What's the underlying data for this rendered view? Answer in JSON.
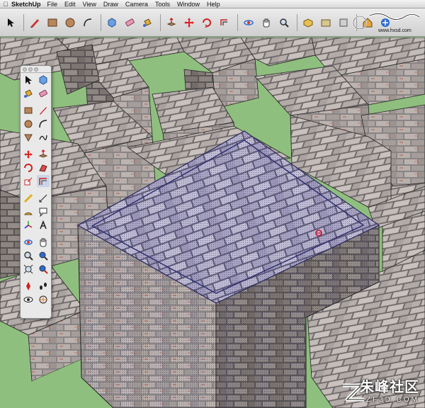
{
  "menubar": {
    "app_name": "SketchUp",
    "menus": [
      "File",
      "Edit",
      "View",
      "Draw",
      "Camera",
      "Tools",
      "Window",
      "Help"
    ]
  },
  "watermark_top": {
    "text": "www.hxsd.com"
  },
  "watermark_bottom": {
    "chinese": "朱峰社区",
    "english": "ZF3D.COM"
  },
  "toolbar": {
    "tools": [
      {
        "icon": "select-arrow-icon"
      },
      {
        "icon": "pencil-icon"
      },
      {
        "icon": "rectangle-icon"
      },
      {
        "icon": "circle-icon"
      },
      {
        "icon": "arc-icon"
      },
      {
        "icon": "make-component-icon"
      },
      {
        "icon": "eraser-icon"
      },
      {
        "icon": "paint-bucket-icon"
      },
      {
        "icon": "push-pull-icon"
      },
      {
        "icon": "move-icon"
      },
      {
        "icon": "rotate-icon"
      },
      {
        "icon": "offset-icon"
      },
      {
        "icon": "orbit-icon"
      },
      {
        "icon": "pan-hand-icon"
      },
      {
        "icon": "zoom-icon"
      },
      {
        "icon": "zoom-extents-icon"
      },
      {
        "icon": "previous-view-icon"
      },
      {
        "icon": "next-view-icon"
      },
      {
        "icon": "3d-warehouse-icon"
      },
      {
        "icon": "share-model-icon"
      }
    ]
  },
  "palette": {
    "rows": [
      [
        "select-arrow-icon",
        "make-component-icon"
      ],
      [
        "paint-bucket-icon",
        "eraser-icon"
      ],
      [
        "rectangle-icon",
        "line-icon"
      ],
      [
        "circle-icon",
        "arc-icon"
      ],
      [
        "polygon-icon",
        "freehand-icon"
      ],
      [
        "move-icon",
        "push-pull-icon"
      ],
      [
        "rotate-icon",
        "follow-me-icon"
      ],
      [
        "scale-icon",
        "offset-icon"
      ],
      [
        "tape-measure-icon",
        "dimension-icon"
      ],
      [
        "protractor-icon",
        "text-icon"
      ],
      [
        "axes-icon",
        "3d-text-icon"
      ],
      [
        "orbit-icon",
        "pan-icon"
      ],
      [
        "zoom-icon",
        "zoom-window-icon"
      ],
      [
        "zoom-extents-icon",
        "previous-icon"
      ],
      [
        "position-camera-icon",
        "walk-icon"
      ],
      [
        "look-around-icon",
        "section-plane-icon"
      ]
    ]
  }
}
